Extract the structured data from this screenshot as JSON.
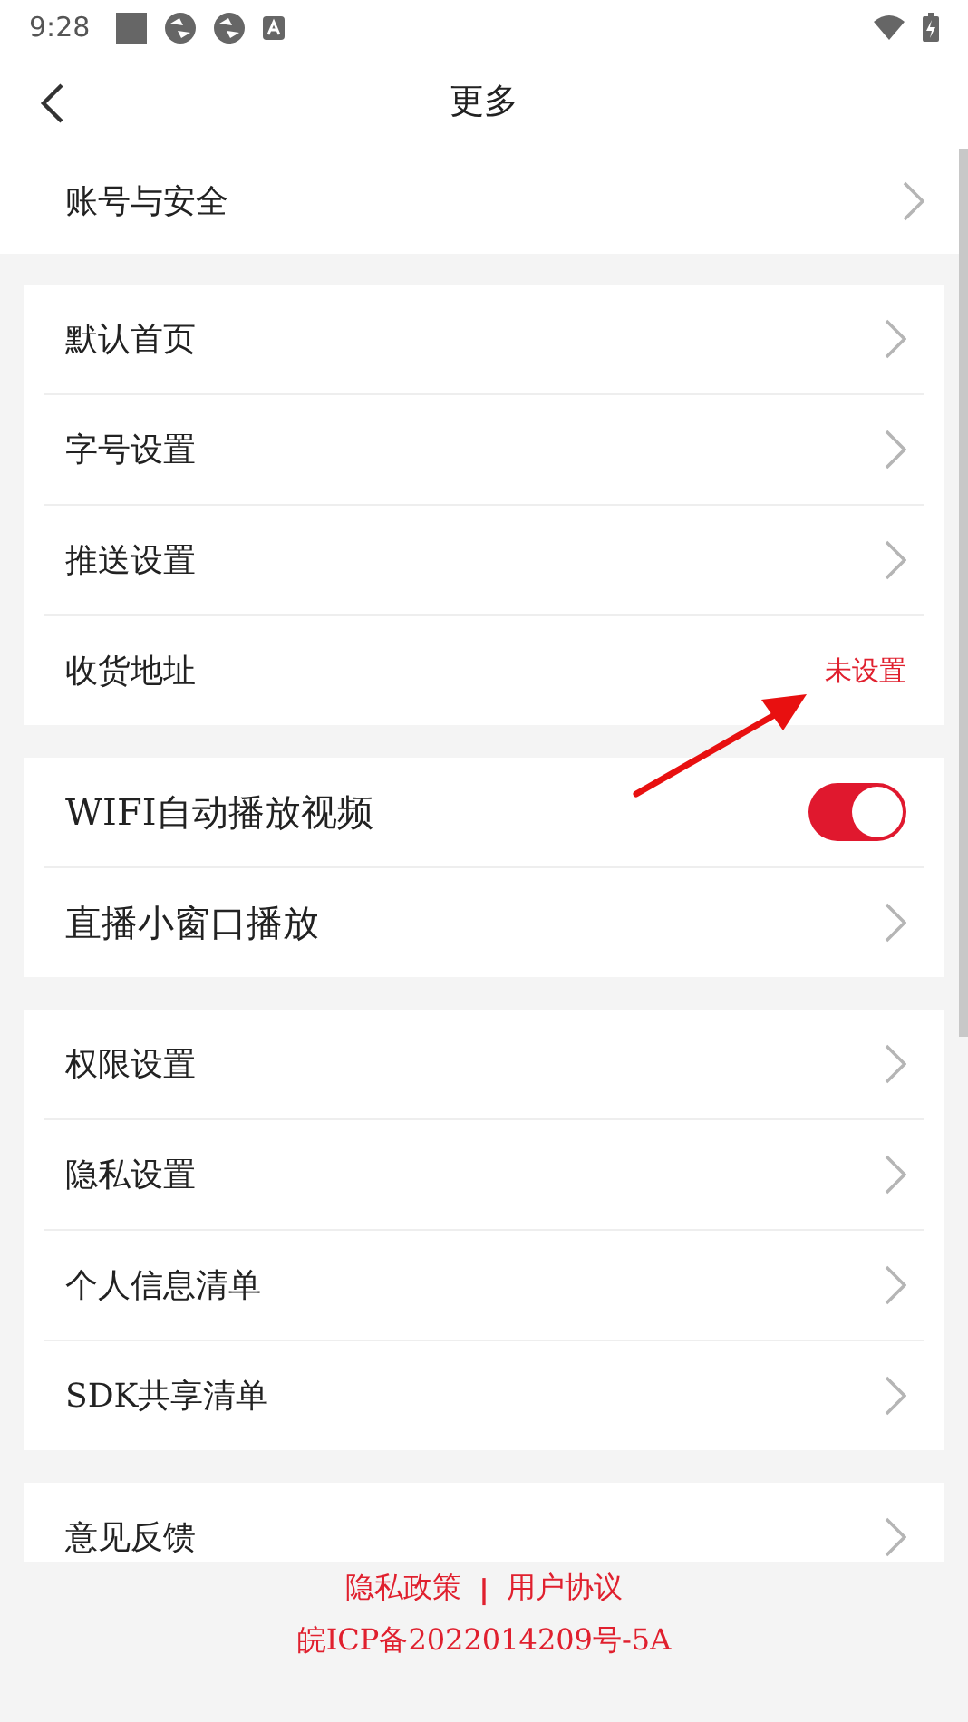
{
  "status_bar": {
    "time": "9:28"
  },
  "header": {
    "title": "更多"
  },
  "account": {
    "label": "账号与安全"
  },
  "groups": [
    {
      "items": [
        {
          "kind": "link",
          "label": "默认首页"
        },
        {
          "kind": "link",
          "label": "字号设置"
        },
        {
          "kind": "link",
          "label": "推送设置"
        },
        {
          "kind": "value",
          "label": "收货地址",
          "value": "未设置"
        }
      ]
    },
    {
      "items": [
        {
          "kind": "toggle",
          "label": "WIFI自动播放视频",
          "on": true
        },
        {
          "kind": "link",
          "label": "直播小窗口播放"
        }
      ]
    },
    {
      "items": [
        {
          "kind": "link",
          "label": "权限设置"
        },
        {
          "kind": "link",
          "label": "隐私设置"
        },
        {
          "kind": "link",
          "label": "个人信息清单"
        },
        {
          "kind": "link",
          "label": "SDK共享清单"
        }
      ]
    },
    {
      "items": [
        {
          "kind": "link",
          "label": "意见反馈"
        }
      ]
    }
  ],
  "footer": {
    "links": [
      "隐私政策",
      "用户协议"
    ],
    "separator": "|",
    "icp": "皖ICP备2022014209号-5A"
  }
}
